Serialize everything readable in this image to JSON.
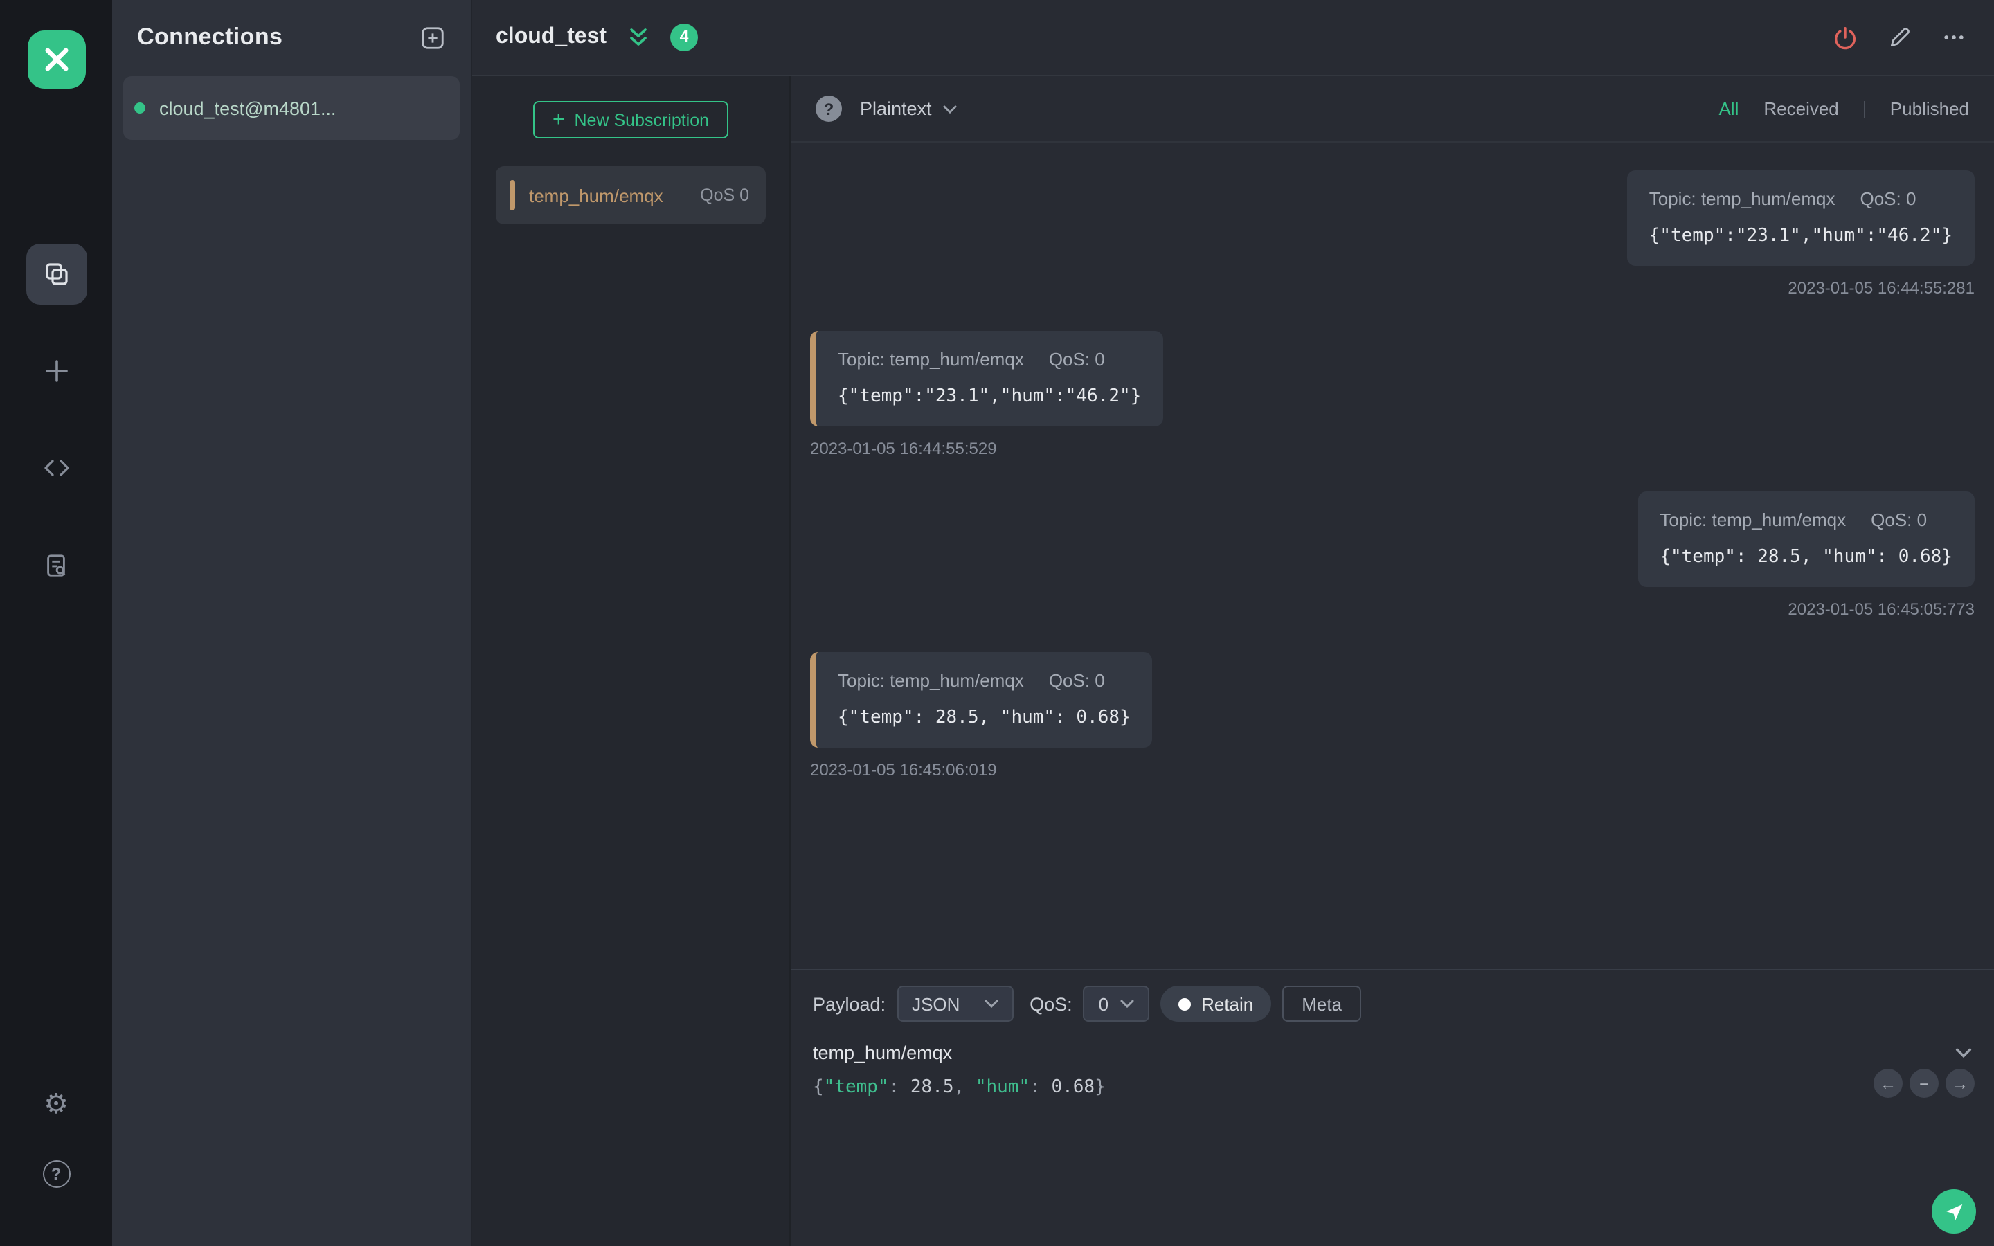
{
  "nav": {
    "items": [
      {
        "name": "connections",
        "active": true
      },
      {
        "name": "new-connection",
        "active": false
      },
      {
        "name": "script",
        "active": false
      },
      {
        "name": "log",
        "active": false
      }
    ],
    "bottom": [
      {
        "name": "settings"
      },
      {
        "name": "help",
        "glyph": "?"
      }
    ],
    "settings_glyph": "⚙",
    "help_glyph": "?"
  },
  "connections_panel": {
    "title": "Connections",
    "items": [
      {
        "name": "cloud_test@m4801...",
        "connected": true
      }
    ]
  },
  "header": {
    "title": "cloud_test",
    "subscription_count": "4"
  },
  "subscriptions": {
    "new_subscription_label": "New Subscription",
    "plus_glyph": "+",
    "items": [
      {
        "topic": "temp_hum/emqx",
        "qos": "QoS 0",
        "marker_color": "#c0986b"
      }
    ]
  },
  "message_bar": {
    "help_glyph": "?",
    "format": "Plaintext",
    "filters": {
      "all": "All",
      "received": "Received",
      "published": "Published"
    },
    "active_filter": "All"
  },
  "messages": [
    {
      "direction": "published",
      "topic": "Topic: temp_hum/emqx",
      "qos": "QoS: 0",
      "payload": "{\"temp\":\"23.1\",\"hum\":\"46.2\"}",
      "time": "2023-01-05 16:44:55:281"
    },
    {
      "direction": "received",
      "topic": "Topic: temp_hum/emqx",
      "qos": "QoS: 0",
      "payload": "{\"temp\":\"23.1\",\"hum\":\"46.2\"}",
      "time": "2023-01-05 16:44:55:529"
    },
    {
      "direction": "published",
      "topic": "Topic: temp_hum/emqx",
      "qos": "QoS: 0",
      "payload": "{\"temp\": 28.5, \"hum\": 0.68}",
      "time": "2023-01-05 16:45:05:773"
    },
    {
      "direction": "received",
      "topic": "Topic: temp_hum/emqx",
      "qos": "QoS: 0",
      "payload": "{\"temp\": 28.5, \"hum\": 0.68}",
      "time": "2023-01-05 16:45:06:019"
    }
  ],
  "publish": {
    "payload_label": "Payload:",
    "format_value": "JSON",
    "qos_label": "QoS:",
    "qos_value": "0",
    "retain_label": "Retain",
    "meta_label": "Meta",
    "topic": "temp_hum/emqx",
    "payload_raw": "{\"temp\": 28.5, \"hum\": 0.68}",
    "payload_tokens": [
      {
        "text": "{",
        "type": "punct"
      },
      {
        "text": "\"temp\"",
        "type": "key"
      },
      {
        "text": ": ",
        "type": "punct"
      },
      {
        "text": "28.5",
        "type": "number"
      },
      {
        "text": ", ",
        "type": "punct"
      },
      {
        "text": "\"hum\"",
        "type": "key"
      },
      {
        "text": ": ",
        "type": "punct"
      },
      {
        "text": "0.68",
        "type": "number"
      },
      {
        "text": "}",
        "type": "punct"
      }
    ],
    "nav_glyphs": {
      "back": "←",
      "remove": "−",
      "forward": "→"
    }
  },
  "colors": {
    "accent_green": "#34c388",
    "topic_marker": "#c0986b",
    "power_red": "#e0635c"
  }
}
